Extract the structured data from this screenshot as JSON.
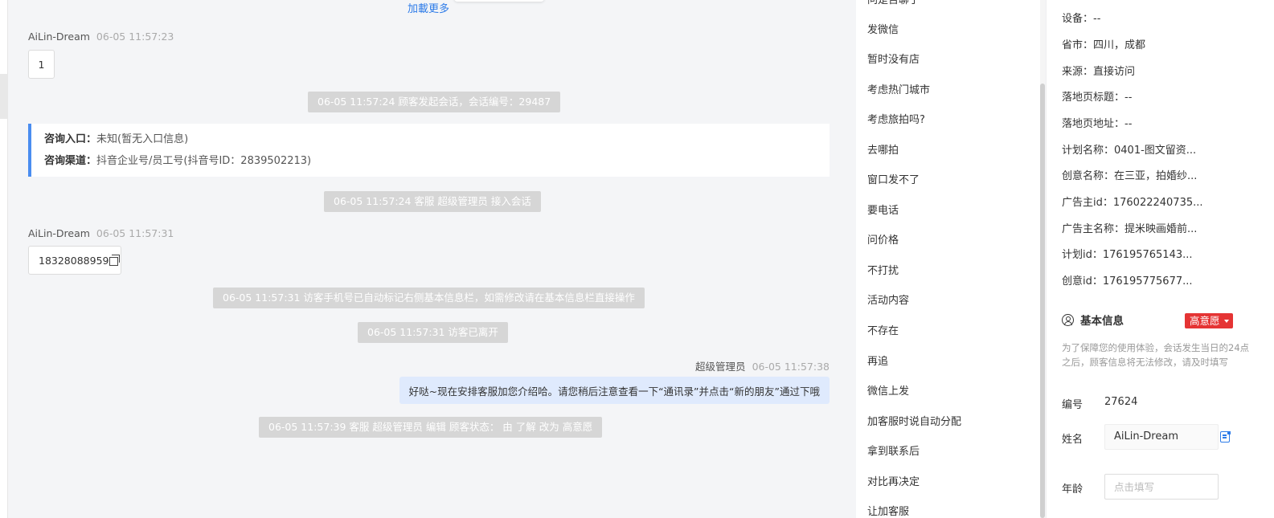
{
  "chat": {
    "load_more": "加載更多",
    "messages": [
      {
        "sender": "AiLin-Dream",
        "time": "06-05 11:57:23",
        "text": "1"
      },
      {
        "sender": "AiLin-Dream",
        "time": "06-05 11:57:31",
        "text": "18328088959"
      }
    ],
    "system": [
      "06-05 11:57:24 顾客发起会话，会话编号：29487",
      "06-05 11:57:24 客服 超级管理员 接入会话",
      "06-05 11:57:31 访客手机号已自动标记右侧基本信息栏，如需修改请在基本信息栏直接操作",
      "06-05 11:57:31 访客已离开",
      "06-05 11:57:39 客服 超级管理员 编辑 顾客状态： 由 了解 改为 高意愿"
    ],
    "info_card": {
      "entry_label": "咨询入口：",
      "entry_value": "未知(暂无入口信息)",
      "channel_label": "咨询渠道：",
      "channel_value": "抖音企业号/员工号(抖音号ID：2839502213)"
    },
    "agent": {
      "name": "超级管理员",
      "time": "06-05 11:57:38",
      "text": "好哒~现在安排客服加您介绍哈。请您稍后注意查看一下“通讯录”并点击“新的朋友”通过下哦"
    }
  },
  "quick_replies": {
    "items": [
      "问是否聊了",
      "发微信",
      "暂时没有店",
      "考虑热门城市",
      "考虑旅拍吗?",
      "去哪拍",
      "窗口发不了",
      "要电话",
      "问价格",
      "不打扰",
      "活动内容",
      "不存在",
      "再追",
      "微信上发",
      "加客服时说自动分配",
      "拿到联系后",
      "对比再决定",
      "让加客服"
    ]
  },
  "customer": {
    "details": [
      "设备：--",
      "省市：四川，成都",
      "来源：直接访问",
      "落地页标题：--",
      "落地页地址：--",
      "计划名称：0401-图文留资...",
      "创意名称：在三亚，拍婚纱...",
      "广告主id：176022240735...",
      "广告主名称：提米映画婚前...",
      "计划id：176195765143...",
      "创意id：176195775677..."
    ],
    "basic_info_title": "基本信息",
    "intent_badge": "高意愿",
    "notice": "为了保障您的使用体验，会话发生当日的24点之后，顾客信息将无法修改，请及时填写",
    "id_label": "编号",
    "id_value": "27624",
    "name_label": "姓名",
    "name_value": "AiLin-Dream",
    "age_label": "年龄",
    "age_placeholder": "点击填写"
  }
}
